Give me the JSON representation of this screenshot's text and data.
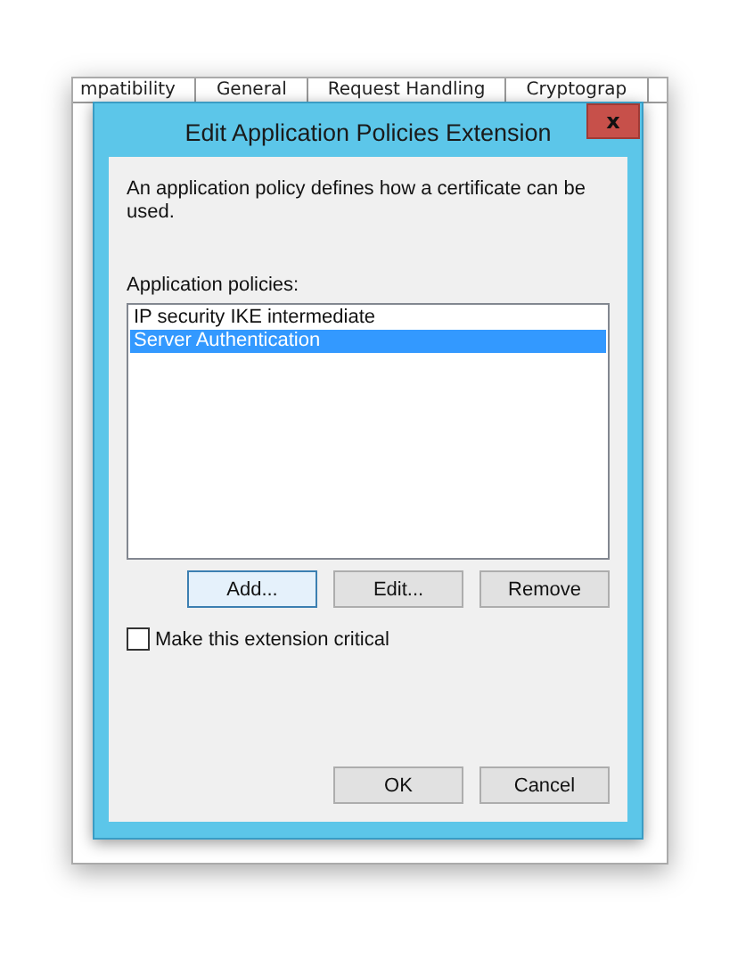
{
  "background_window": {
    "tabs": [
      {
        "label": "mpatibility",
        "selected": false
      },
      {
        "label": "General",
        "selected": false
      },
      {
        "label": "Request Handling",
        "selected": false
      },
      {
        "label": "Cryptograp",
        "selected": false
      }
    ]
  },
  "dialog": {
    "title": "Edit Application Policies Extension",
    "close": "x",
    "description": "An application policy defines how a certificate can be used.",
    "list_label": "Application policies:",
    "policies": [
      {
        "label": "IP security IKE intermediate",
        "selected": false
      },
      {
        "label": "Server Authentication",
        "selected": true
      }
    ],
    "list_buttons": [
      {
        "label": "Add...",
        "focused": true
      },
      {
        "label": "Edit...",
        "focused": false
      },
      {
        "label": "Remove",
        "focused": false
      }
    ],
    "critical": {
      "label": "Make this extension critical",
      "checked": false
    },
    "buttons": [
      "OK",
      "Cancel"
    ]
  }
}
